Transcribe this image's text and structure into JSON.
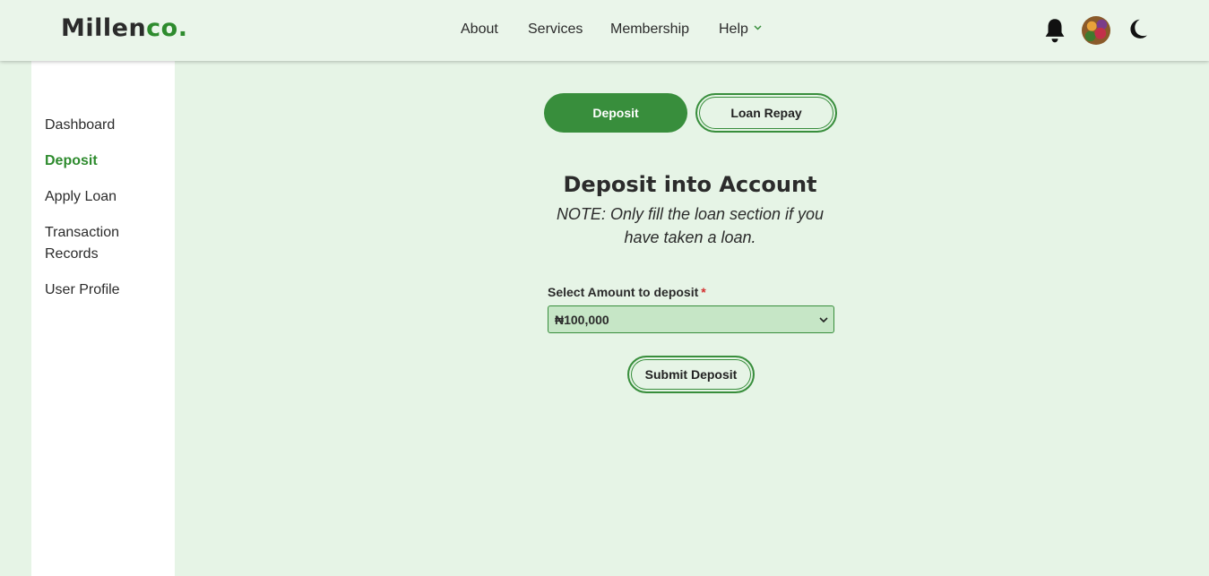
{
  "brand": {
    "name": "Millen",
    "accent": "co."
  },
  "nav": {
    "about": "About",
    "services": "Services",
    "membership": "Membership",
    "help": "Help"
  },
  "sidebar": {
    "items": [
      {
        "label": "Dashboard",
        "active": false
      },
      {
        "label": "Deposit",
        "active": true
      },
      {
        "label": "Apply Loan",
        "active": false
      },
      {
        "label": "Transaction Records",
        "active": false
      },
      {
        "label": "User Profile",
        "active": false
      }
    ]
  },
  "tabs": {
    "deposit": "Deposit",
    "loan_repay": "Loan Repay"
  },
  "main": {
    "heading": "Deposit into Account",
    "note": "NOTE: Only fill the loan section if you have taken a loan."
  },
  "form": {
    "amount_label": "Select Amount to deposit",
    "required_mark": "*",
    "amount_value": "₦100,000",
    "submit_label": "Submit Deposit"
  },
  "icons": {
    "bell": "bell-icon",
    "avatar": "avatar",
    "theme": "moon-icon",
    "help_chevron": "chevron-down-icon"
  },
  "colors": {
    "brand_green": "#388e3c",
    "background": "#e6f4e6",
    "select_bg": "#c6e6c6",
    "required": "#d32f2f"
  }
}
